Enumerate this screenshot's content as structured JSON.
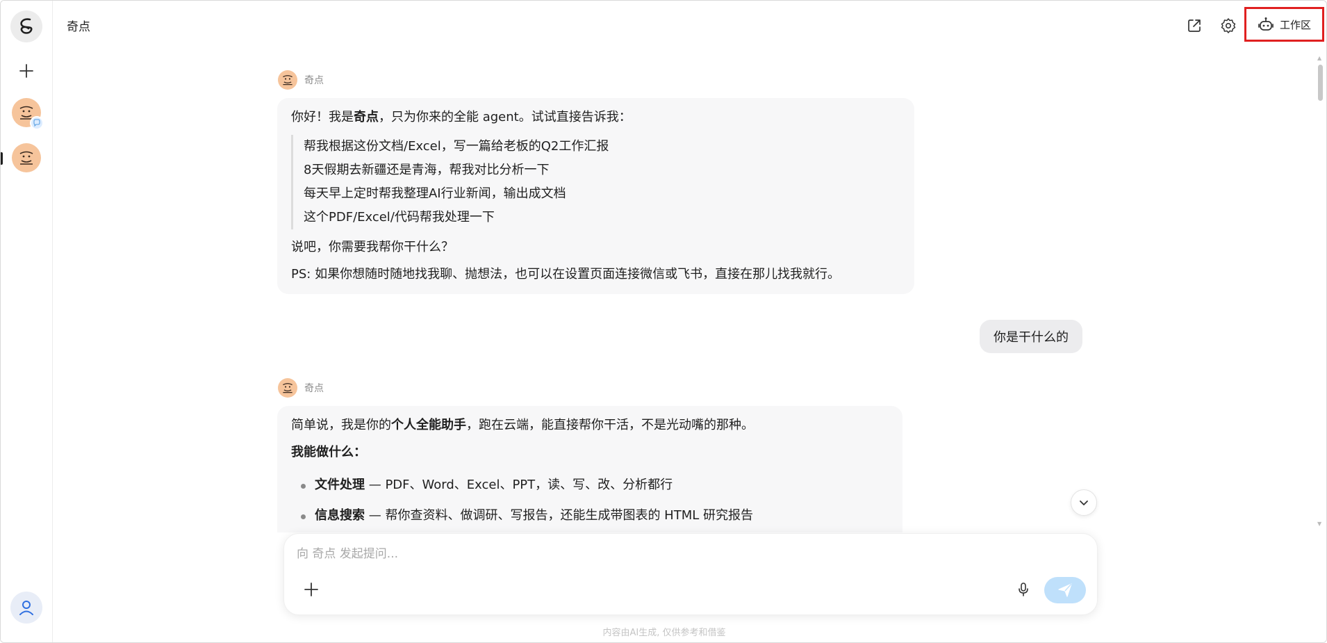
{
  "app": {
    "title": "奇点"
  },
  "header": {
    "workspace_label": "工作区"
  },
  "messages": {
    "bot_name": "奇点",
    "bot1": {
      "intro_prefix": "你好！我是",
      "intro_bold": "奇点",
      "intro_suffix": "，只为你来的全能 agent。试试直接告诉我：",
      "examples": [
        "帮我根据这份文档/Excel，写一篇给老板的Q2工作汇报",
        "8天假期去新疆还是青海，帮我对比分析一下",
        "每天早上定时帮我整理AI行业新闻，输出成文档",
        "这个PDF/Excel/代码帮我处理一下"
      ],
      "ask": "说吧，你需要我帮你干什么？",
      "ps": "PS: 如果你想随时随地找我聊、抛想法，也可以在设置页面连接微信或飞书，直接在那儿找我就行。"
    },
    "user1": "你是干什么的",
    "bot2": {
      "line1_prefix": "简单说，我是你的",
      "line1_bold": "个人全能助手",
      "line1_suffix": "，跑在云端，能直接帮你干活，不是光动嘴的那种。",
      "capabilities_heading": "我能做什么：",
      "capabilities": [
        {
          "title": "文件处理",
          "desc": " — PDF、Word、Excel、PPT，读、写、改、分析都行"
        },
        {
          "title": "信息搜索",
          "desc": " — 帮你查资料、做调研、写报告，还能生成带图表的 HTML 研究报告"
        }
      ]
    }
  },
  "composer": {
    "placeholder": "向 奇点 发起提问..."
  },
  "footer": {
    "disclaimer": "内容由AI生成, 仅供参考和借鉴"
  },
  "colors": {
    "accent_red": "#e02020",
    "send_button": "#bfe0fb",
    "avatar_bg": "#f6c49b",
    "bubble_bg": "#f7f7f8"
  },
  "icons": {
    "logo": "logo-icon",
    "new_chat": "plus-icon",
    "share": "share-icon",
    "settings": "gear-icon",
    "workspace": "robot-icon",
    "scroll_down": "chevron-down-icon",
    "mic": "mic-icon",
    "send": "send-icon",
    "user": "user-icon"
  }
}
